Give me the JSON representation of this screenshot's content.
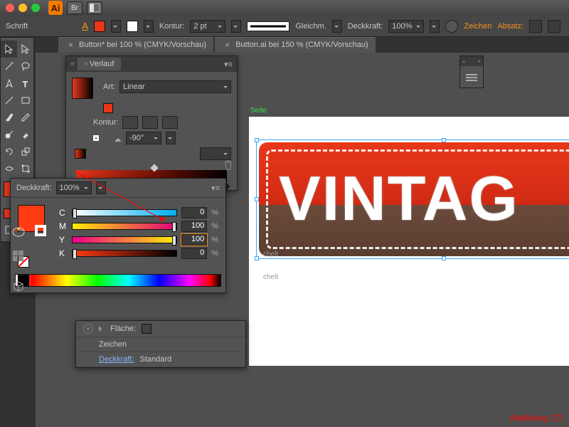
{
  "titlebar": {
    "ai": "Ai",
    "br": "Br"
  },
  "ctrlbar": {
    "schrift": "Schrift",
    "stroke_icon": "A",
    "kontur": "Kontur:",
    "stroke_weight": "2 pt",
    "gleichm": "Gleichm.",
    "deckkraft": "Deckkraft:",
    "opacity": "100%",
    "zeichen": "Zeichen",
    "absatz": "Absatz:"
  },
  "tabs": [
    {
      "label": "Button* bei 100 % (CMYK/Vorschau)"
    },
    {
      "label": "Button.ai bei 150 % (CMYK/Vorschau)"
    }
  ],
  "canvas": {
    "seite": "Seite",
    "vintage": "VINTAG"
  },
  "grad": {
    "title": "Verlauf",
    "art": "Art:",
    "type": "Linear",
    "kontur": "Kontur:",
    "angle": "-90°"
  },
  "color_deck": {
    "label": "Deckkraft:",
    "value": "100%"
  },
  "cmyk": {
    "c": {
      "label": "C",
      "val": "0"
    },
    "m": {
      "label": "M",
      "val": "100"
    },
    "y": {
      "label": "Y",
      "val": "100"
    },
    "k": {
      "label": "K",
      "val": "0"
    },
    "pct": "%"
  },
  "appear": {
    "flaeche": "Fläche:",
    "zeichen": "Zeichen",
    "deckkraft": "Deckkraft:",
    "standard": "Standard",
    "chelt": "chelt"
  },
  "footer": {
    "abb": "Abbildung: 23"
  }
}
